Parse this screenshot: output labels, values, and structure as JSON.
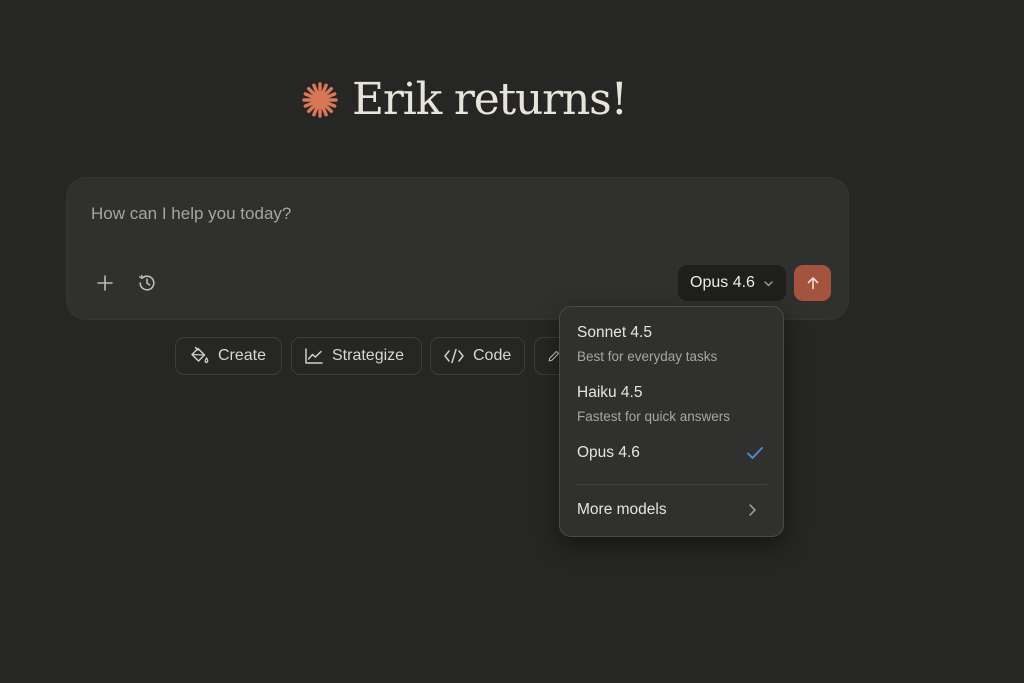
{
  "greeting": {
    "title": "Erik returns!",
    "spark_icon": "claude-spark-icon",
    "spark_color": "#d97757"
  },
  "composer": {
    "placeholder": "How can I help you today?",
    "value": "",
    "add_icon": "plus-icon",
    "history_icon": "clock-history-icon",
    "model_select": {
      "label": "Opus 4.6",
      "icon": "chevron-down-icon"
    },
    "send_icon": "arrow-up-icon",
    "send_color": "#a4533f"
  },
  "chips": [
    {
      "label": "Create",
      "icon": "paint-bucket-icon"
    },
    {
      "label": "Strategize",
      "icon": "line-chart-icon"
    },
    {
      "label": "Code",
      "icon": "code-brackets-icon"
    },
    {
      "label": "",
      "icon": "pen-icon"
    }
  ],
  "model_menu": {
    "items": [
      {
        "name": "Sonnet 4.5",
        "description": "Best for everyday tasks",
        "selected": false
      },
      {
        "name": "Haiku 4.5",
        "description": "Fastest for quick answers",
        "selected": false
      },
      {
        "name": "Opus 4.6",
        "description": "",
        "selected": true
      }
    ],
    "check_icon": "checkmark-icon",
    "check_color": "#4f8fd9",
    "more": {
      "label": "More models",
      "icon": "chevron-right-icon"
    }
  }
}
